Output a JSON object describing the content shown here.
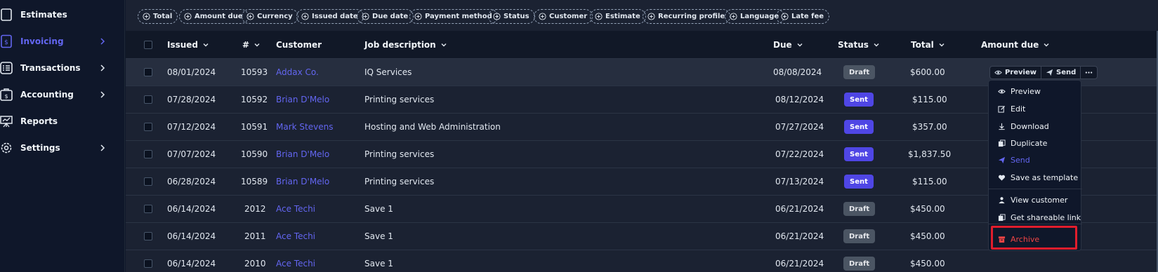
{
  "sidebar": {
    "items": [
      {
        "label": "Estimates",
        "icon": "estimates-icon",
        "active": false,
        "chevron": false
      },
      {
        "label": "Invoicing",
        "icon": "invoice-icon",
        "active": true,
        "chevron": true
      },
      {
        "label": "Transactions",
        "icon": "list-icon",
        "active": false,
        "chevron": true
      },
      {
        "label": "Accounting",
        "icon": "accounting-icon",
        "active": false,
        "chevron": true
      },
      {
        "label": "Reports",
        "icon": "presentation-icon",
        "active": false,
        "chevron": false
      },
      {
        "label": "Settings",
        "icon": "gear-icon",
        "active": false,
        "chevron": true
      }
    ]
  },
  "filters": [
    "Total",
    "Amount due",
    "Currency",
    "Issued date",
    "Due date",
    "Payment method",
    "Status",
    "Customer",
    "Estimate",
    "Recurring profile",
    "Language",
    "Late fee"
  ],
  "table": {
    "columns": {
      "issued": "Issued",
      "number": "#",
      "customer": "Customer",
      "job": "Job description",
      "due": "Due",
      "status": "Status",
      "total": "Total",
      "amount_due": "Amount due"
    },
    "rows": [
      {
        "issued": "08/01/2024",
        "number": "10593",
        "customer": "Addax Co.",
        "job": "IQ Services",
        "due": "08/08/2024",
        "status": "Draft",
        "total": "$600.00"
      },
      {
        "issued": "07/28/2024",
        "number": "10592",
        "customer": "Brian D'Melo",
        "job": "Printing services",
        "due": "08/12/2024",
        "status": "Sent",
        "total": "$115.00"
      },
      {
        "issued": "07/12/2024",
        "number": "10591",
        "customer": "Mark Stevens",
        "job": "Hosting and Web Administration",
        "due": "07/27/2024",
        "status": "Sent",
        "total": "$357.00"
      },
      {
        "issued": "07/07/2024",
        "number": "10590",
        "customer": "Brian D'Melo",
        "job": "Printing services",
        "due": "07/22/2024",
        "status": "Sent",
        "total": "$1,837.50"
      },
      {
        "issued": "06/28/2024",
        "number": "10589",
        "customer": "Brian D'Melo",
        "job": "Printing services",
        "due": "07/13/2024",
        "status": "Sent",
        "total": "$115.00"
      },
      {
        "issued": "06/14/2024",
        "number": "2012",
        "customer": "Ace Techi",
        "job": "Save 1",
        "due": "06/21/2024",
        "status": "Draft",
        "total": "$450.00"
      },
      {
        "issued": "06/14/2024",
        "number": "2011",
        "customer": "Ace Techi",
        "job": "Save 1",
        "due": "06/21/2024",
        "status": "Draft",
        "total": "$450.00"
      },
      {
        "issued": "06/14/2024",
        "number": "2010",
        "customer": "Ace Techi",
        "job": "Save 1",
        "due": "06/21/2024",
        "status": "Draft",
        "total": "$450.00"
      }
    ]
  },
  "row_actions": {
    "preview": "Preview",
    "send": "Send"
  },
  "menu": {
    "items": [
      {
        "label": "Preview",
        "icon": "eye-icon"
      },
      {
        "label": "Edit",
        "icon": "edit-icon"
      },
      {
        "label": "Download",
        "icon": "download-icon"
      },
      {
        "label": "Duplicate",
        "icon": "duplicate-icon"
      },
      {
        "label": "Send",
        "icon": "send-icon"
      },
      {
        "label": "Save as template",
        "icon": "heart-icon"
      },
      {
        "label": "View customer",
        "icon": "user-icon"
      },
      {
        "label": "Get shareable link",
        "icon": "link-doc-icon"
      },
      {
        "label": "Archive",
        "icon": "archive-icon"
      }
    ]
  },
  "colors": {
    "accent": "#6366f1",
    "archive": "#ef4444",
    "highlight_box": "#e11d2c"
  }
}
